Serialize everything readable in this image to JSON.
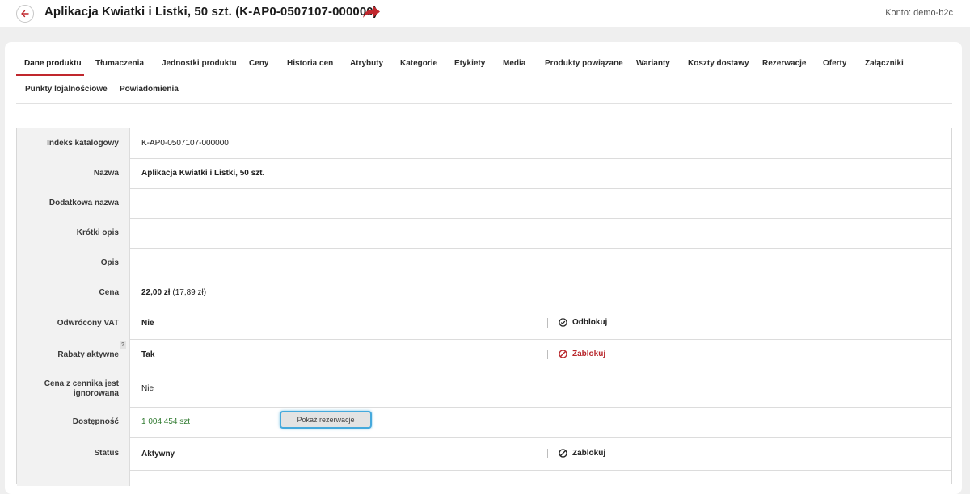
{
  "header": {
    "title": "Aplikacja Kwiatki i Listki, 50 szt. (K-AP0-0507107-000000)",
    "account_label": "Konto: demo-b2c",
    "accent_color": "#c0272d"
  },
  "tabs": [
    {
      "label": "Dane produktu",
      "active": true
    },
    {
      "label": "Tłumaczenia"
    },
    {
      "label": "Jednostki produktu"
    },
    {
      "label": "Ceny"
    },
    {
      "label": "Historia cen"
    },
    {
      "label": "Atrybuty"
    },
    {
      "label": "Kategorie"
    },
    {
      "label": "Etykiety"
    },
    {
      "label": "Media"
    },
    {
      "label": "Produkty powiązane"
    },
    {
      "label": "Warianty"
    },
    {
      "label": "Koszty dostawy"
    },
    {
      "label": "Rezerwacje"
    },
    {
      "label": "Oferty"
    },
    {
      "label": "Załączniki"
    },
    {
      "label": "Punkty lojalnościowe"
    },
    {
      "label": "Powiadomienia"
    }
  ],
  "fields": {
    "catalog_index": {
      "label": "Indeks katalogowy",
      "value": "K-AP0-0507107-000000"
    },
    "name": {
      "label": "Nazwa",
      "value": "Aplikacja Kwiatki i Listki, 50 szt."
    },
    "additional_name": {
      "label": "Dodatkowa nazwa",
      "value": ""
    },
    "short_desc": {
      "label": "Krótki opis",
      "value": ""
    },
    "description": {
      "label": "Opis",
      "value": ""
    },
    "price": {
      "label": "Cena",
      "value": "22,00 zł",
      "net": "(17,89 zł)"
    },
    "reverse_vat": {
      "label": "Odwrócony VAT",
      "value": "Nie",
      "action": "Odblokuj"
    },
    "discounts": {
      "label": "Rabaty aktywne",
      "value": "Tak",
      "action": "Zablokuj",
      "help": "?"
    },
    "pricelist_ignored": {
      "label": "Cena z cennika jest ignorowana",
      "value": "Nie"
    },
    "availability": {
      "label": "Dostępność",
      "value": "1 004 454 szt",
      "button": "Pokaż rezerwacje"
    },
    "status": {
      "label": "Status",
      "value": "Aktywny",
      "action": "Zablokuj"
    }
  }
}
